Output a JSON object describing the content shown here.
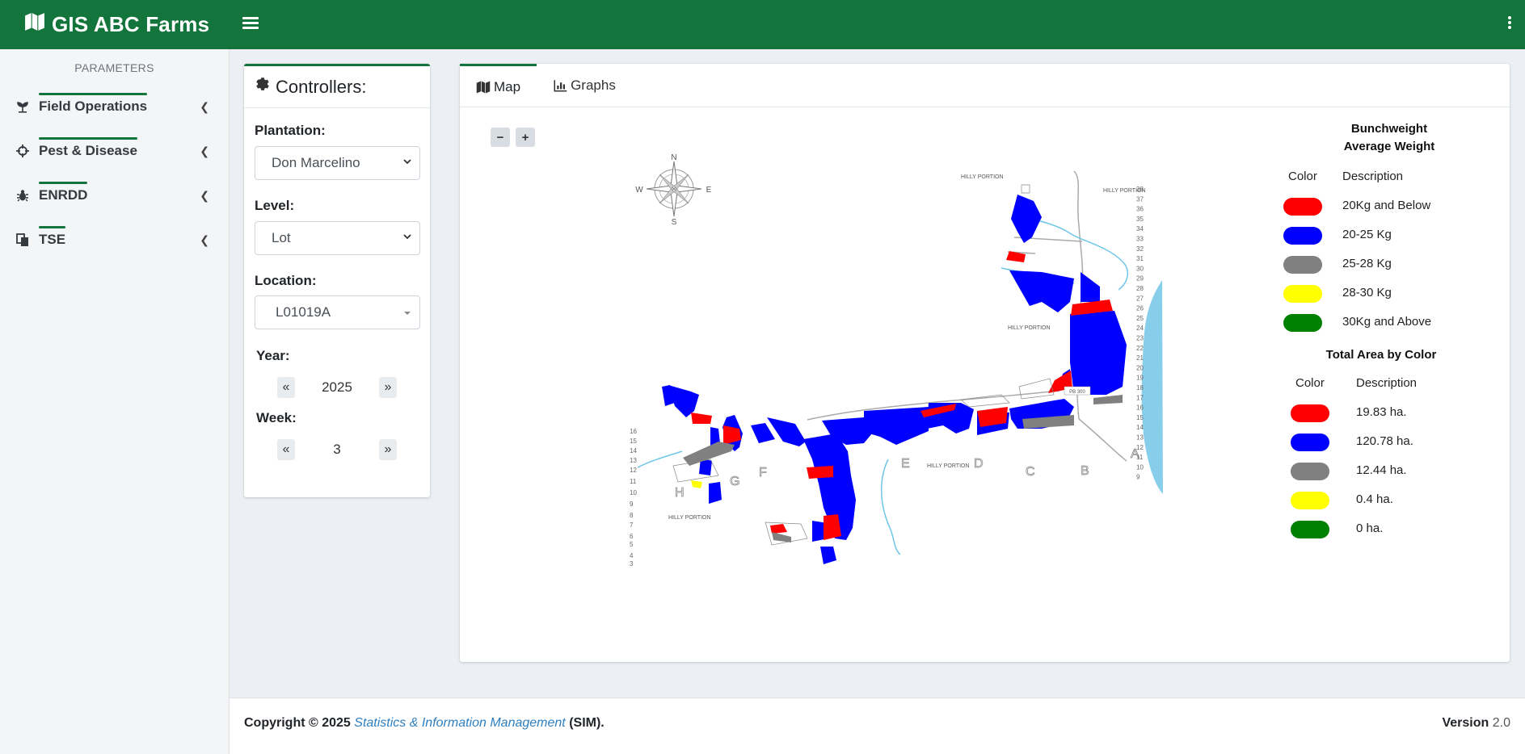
{
  "app": {
    "title": "GIS ABC Farms"
  },
  "sidebar": {
    "header": "PARAMETERS",
    "items": [
      {
        "label": "Field Operations",
        "icon": "seedling-icon"
      },
      {
        "label": "Pest & Disease",
        "icon": "crosshair-icon"
      },
      {
        "label": "ENRDD",
        "icon": "bug-icon"
      },
      {
        "label": "TSE",
        "icon": "copy-icon"
      }
    ]
  },
  "controllers": {
    "title": "Controllers:",
    "plantation_label": "Plantation:",
    "plantation_value": "Don Marcelino",
    "level_label": "Level:",
    "level_value": "Lot",
    "location_label": "Location:",
    "location_value": "L01019A",
    "year_label": "Year:",
    "year_value": "2025",
    "week_label": "Week:",
    "week_value": "3"
  },
  "tabs": {
    "map": "Map",
    "graphs": "Graphs"
  },
  "map": {
    "zoom_out": "−",
    "zoom_in": "+",
    "compass": {
      "n": "N",
      "s": "S",
      "e": "E",
      "w": "W"
    },
    "hilly_labels": [
      "HILLY PORTION",
      "HILLY PORTION",
      "HILLY PORTION",
      "HILLY PORTION",
      "HILLY PORTION"
    ],
    "block_letters": [
      "H",
      "G",
      "F",
      "E",
      "D",
      "C",
      "B",
      "A"
    ],
    "left_numbers": [
      "16",
      "15",
      "14",
      "13",
      "12",
      "11",
      "10",
      "9",
      "8",
      "7",
      "6",
      "5",
      "4",
      "3"
    ],
    "right_numbers": [
      "38",
      "37",
      "36",
      "35",
      "34",
      "33",
      "32",
      "31",
      "30",
      "29",
      "28",
      "27",
      "26",
      "25",
      "24",
      "23",
      "22",
      "21",
      "20",
      "19",
      "18",
      "17",
      "16",
      "15",
      "14",
      "13",
      "12",
      "11",
      "10",
      "9"
    ],
    "tag": "PB 300"
  },
  "legend": {
    "weight_title_1": "Bunchweight",
    "weight_title_2": "Average Weight",
    "col_color": "Color",
    "col_desc": "Description",
    "weight_items": [
      {
        "color": "#ff0000",
        "label": "20Kg and Below"
      },
      {
        "color": "#0000ff",
        "label": "20-25 Kg"
      },
      {
        "color": "#808080",
        "label": "25-28 Kg"
      },
      {
        "color": "#ffff00",
        "label": "28-30 Kg"
      },
      {
        "color": "#008000",
        "label": "30Kg and Above"
      }
    ],
    "area_title": "Total Area by Color",
    "area_items": [
      {
        "color": "#ff0000",
        "label": "19.83 ha."
      },
      {
        "color": "#0000ff",
        "label": "120.78 ha."
      },
      {
        "color": "#808080",
        "label": "12.44 ha."
      },
      {
        "color": "#ffff00",
        "label": "0.4 ha."
      },
      {
        "color": "#008000",
        "label": "0 ha."
      }
    ]
  },
  "footer": {
    "copyright_prefix": "Copyright © 2025",
    "org_link": "Statistics & Information Management",
    "suffix": "(SIM).",
    "version_label": "Version",
    "version_value": "2.0"
  },
  "colors": {
    "brand": "#13743c",
    "accent_link": "#2f7fbf",
    "sea": "#87ceeb"
  }
}
